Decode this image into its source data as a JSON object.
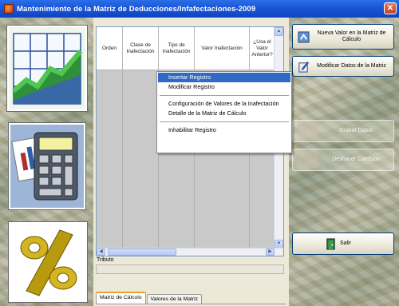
{
  "window": {
    "title": "Mantenimiento de la Matriz de Deducciones/Infafectaciones-2009",
    "icon": "app-icon",
    "close_label": "✕"
  },
  "grid": {
    "columns": [
      "Orden",
      "Clase de Inafectación",
      "Tipo de Inafectación",
      "Valor Inafectación",
      "¿Usa el Valor Anterior?"
    ],
    "rows": []
  },
  "context_menu": {
    "items": [
      {
        "label": "Insertar Registro",
        "selected": true
      },
      {
        "label": "Modificar Registro",
        "selected": false
      },
      {
        "label": "Configuración de Valores de la Inafectación",
        "selected": false
      },
      {
        "label": "Detalle de la Matriz de Cálculo",
        "selected": false
      },
      {
        "label": "Inhabilitar Registro",
        "selected": false
      }
    ]
  },
  "tributo": {
    "label": "Tributo",
    "value": ""
  },
  "tabs": [
    {
      "label": "Matriz de Cálculo",
      "active": true
    },
    {
      "label": "Valores de la Matriz",
      "active": false
    }
  ],
  "buttons": {
    "nuevo_valor": "Nueva Valor en la Matriz de Cálculo",
    "modificar": "Modificar Datos de la Matriz",
    "grabar": "Grabar Datos",
    "deshacer": "Deshacer Cambios",
    "salir": "Salir"
  },
  "colors": {
    "titlebar": "#0d44c4",
    "selection": "#316ac5",
    "grid_empty": "#c9c9c9"
  }
}
